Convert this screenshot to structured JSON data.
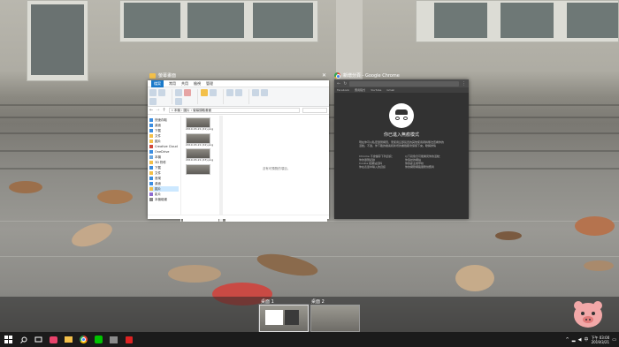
{
  "explorer": {
    "title": "螢幕畫面",
    "ribbon_tabs": [
      "檔案",
      "常用",
      "共用",
      "檢視",
      "管理"
    ],
    "address": "« 本機 › 圖片 › 螢幕擷取畫面",
    "nav_items": [
      "快速存取",
      "桌面",
      "下載",
      "文件",
      "圖片",
      "Creative Cloud",
      "OneDrive",
      "本機",
      "3D 物件",
      "下載",
      "文件",
      "音樂",
      "桌面",
      "圖片",
      "影片",
      "本機磁碟"
    ],
    "thumbnail_labels": [
      "2019-03-21 (41).png",
      "2019-03-21 (42).png",
      "2019-03-21 (43).png"
    ],
    "preview_text": "沒有可預覽的項目。"
  },
  "chrome": {
    "title": "新增分頁 - Google Chrome",
    "bookmarks": [
      "Facebook",
      "應用程式",
      "YouTube",
      "Gmail"
    ],
    "incognito_title": "你已進入無痕模式",
    "incognito_desc": "現在你可以私密瀏覽網頁，而使用這部裝置的其他使用者將無法查看你的活動。不過，你下載的檔案和新增的書籤都會保留下來。瞭解詳情",
    "wont_save_heading": "Chrome 不會儲存下列資訊：",
    "wont_save": [
      "你的瀏覽記錄",
      "Cookie 和網站資料",
      "你在表單中輸入的資訊"
    ],
    "may_see_heading": "以下對象仍可能看見你的活動：",
    "may_see": [
      "你造訪的網站",
      "你的雇主或學校",
      "你的網際網路服務供應商"
    ]
  },
  "desktops": [
    {
      "label": "桌面 1",
      "active": true
    },
    {
      "label": "桌面 2",
      "active": false
    }
  ],
  "taskbar": {
    "clock_time": "下午 03:00",
    "clock_date": "2019/3/21",
    "input_lang": "中"
  },
  "colors": {
    "taskbar": "#1b1b1b",
    "file_tab": "#1979ca",
    "incognito_bg": "#323232"
  }
}
